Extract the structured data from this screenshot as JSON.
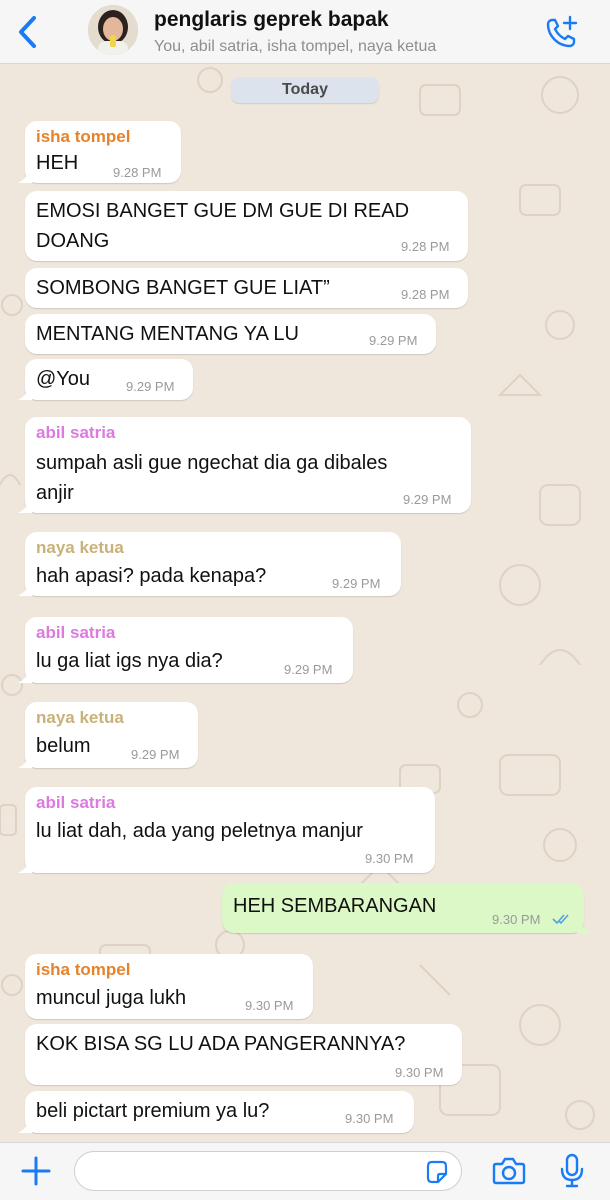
{
  "header": {
    "title": "penglaris geprek bapak",
    "subtitle": "You, abil satria, isha tompel, naya ketua"
  },
  "date_label": "Today",
  "colors": {
    "accent": "#1a7cf5",
    "isha_tompel": "#e6832a",
    "abil_satria": "#dc7ae0",
    "naya_ketua": "#c9b27a",
    "outgoing_bubble": "#dcf8c6",
    "read_ticks": "#4fa3e6"
  },
  "messages": [
    {
      "sender": "isha tompel",
      "text": "HEH",
      "time": "9.28 PM"
    },
    {
      "text": "EMOSI BANGET GUE DM GUE DI READ",
      "text2": "DOANG",
      "time": "9.28 PM"
    },
    {
      "text": "SOMBONG BANGET GUE LIAT”",
      "time": "9.28 PM"
    },
    {
      "text": "MENTANG MENTANG YA LU",
      "time": "9.29 PM"
    },
    {
      "text": "@You",
      "time": "9.29 PM"
    },
    {
      "sender": "abil satria",
      "text": "sumpah asli gue ngechat dia ga dibales",
      "text2": "anjir",
      "time": "9.29 PM"
    },
    {
      "sender": "naya ketua",
      "text": "hah apasi? pada kenapa?",
      "time": "9.29 PM"
    },
    {
      "sender": "abil satria",
      "text": "lu ga liat igs nya dia?",
      "time": "9.29 PM"
    },
    {
      "sender": "naya ketua",
      "text": "belum",
      "time": "9.29 PM"
    },
    {
      "sender": "abil satria",
      "text": "lu liat dah, ada yang peletnya manjur",
      "time": "9.30 PM"
    },
    {
      "text": "HEH SEMBARANGAN",
      "time": "9.30 PM",
      "outgoing": true,
      "status": "read"
    },
    {
      "sender": "isha tompel",
      "text": "muncul juga lukh",
      "time": "9.30 PM"
    },
    {
      "text": "KOK BISA SG LU ADA PANGERANNYA?",
      "time": "9.30 PM"
    },
    {
      "text": "beli pictart premium ya lu?",
      "time": "9.30 PM"
    }
  ],
  "icons": {
    "back": "chevron-left-icon",
    "call": "phone-plus-icon",
    "add": "plus-icon",
    "sticker": "sticker-icon",
    "camera": "camera-icon",
    "mic": "microphone-icon"
  }
}
